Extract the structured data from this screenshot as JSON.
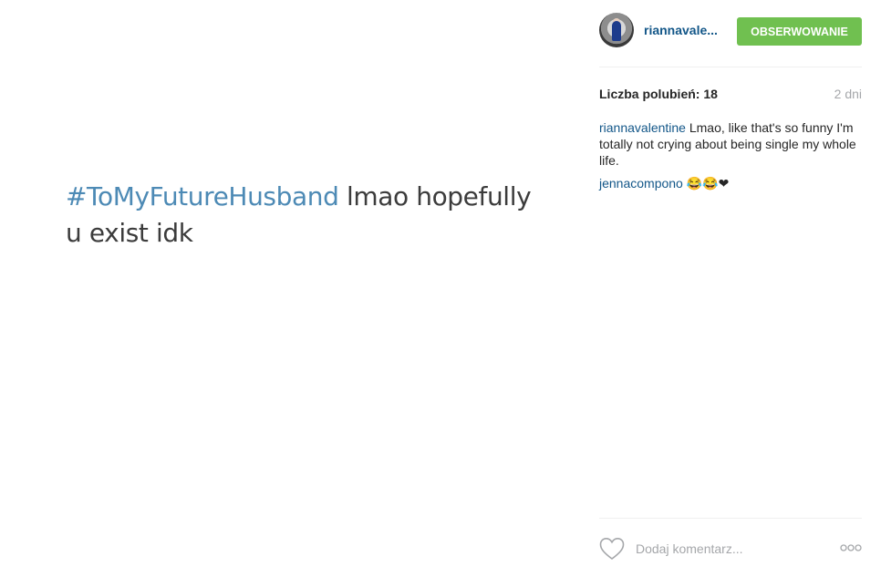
{
  "post": {
    "image_text": {
      "hashtag": "#ToMyFutureHusband",
      "body": " lmao hopefully u exist idk"
    }
  },
  "header": {
    "username": "riannavale...",
    "follow_label": "OBSERWOWANIE"
  },
  "meta": {
    "likes": "Liczba polubień: 18",
    "time_ago": "2 dni"
  },
  "comments": [
    {
      "author": "riannavalentine",
      "text": " Lmao, like that's so funny I'm totally not crying about being single my whole life."
    },
    {
      "author": "jennacompono",
      "text": " 😂😂❤"
    }
  ],
  "footer": {
    "comment_placeholder": "Dodaj komentarz...",
    "more_icon": "more-options-icon",
    "like_icon": "heart-outline-icon"
  },
  "colors": {
    "link": "#125688",
    "follow_button": "#70c050",
    "hashtag": "#4d8ab5"
  }
}
